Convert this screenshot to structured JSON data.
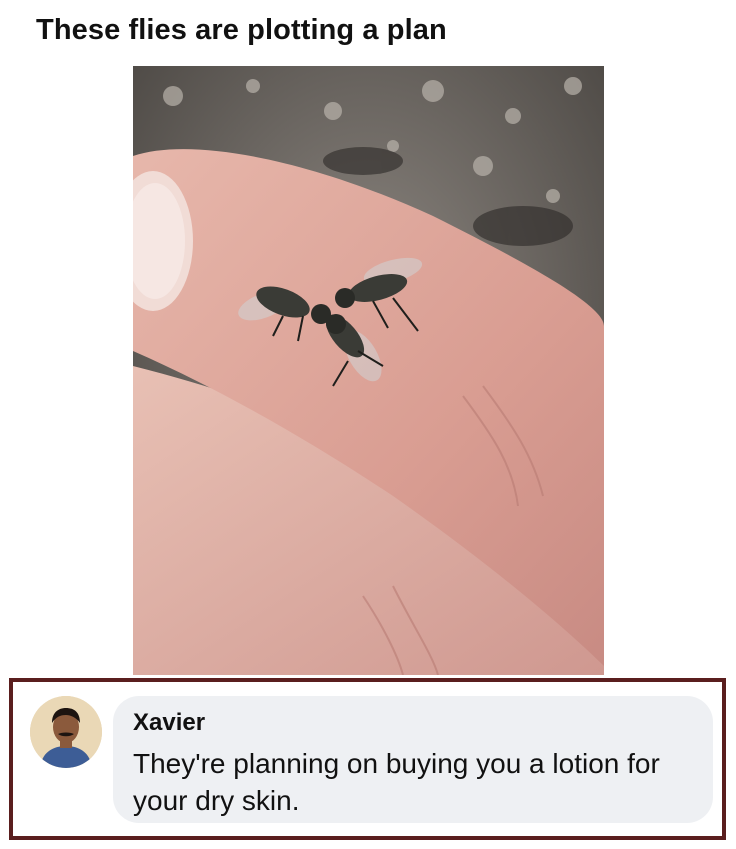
{
  "post": {
    "title": "These flies are plotting a plan",
    "photo_icon": "flies-on-finger-photo"
  },
  "comment": {
    "avatar_icon": "user-avatar",
    "author": "Xavier",
    "text": "They're planning on buying you a lotion for your dry skin."
  },
  "colors": {
    "frame_border": "#5a1e1e",
    "bubble_bg": "#eef0f3",
    "text": "#111111"
  }
}
